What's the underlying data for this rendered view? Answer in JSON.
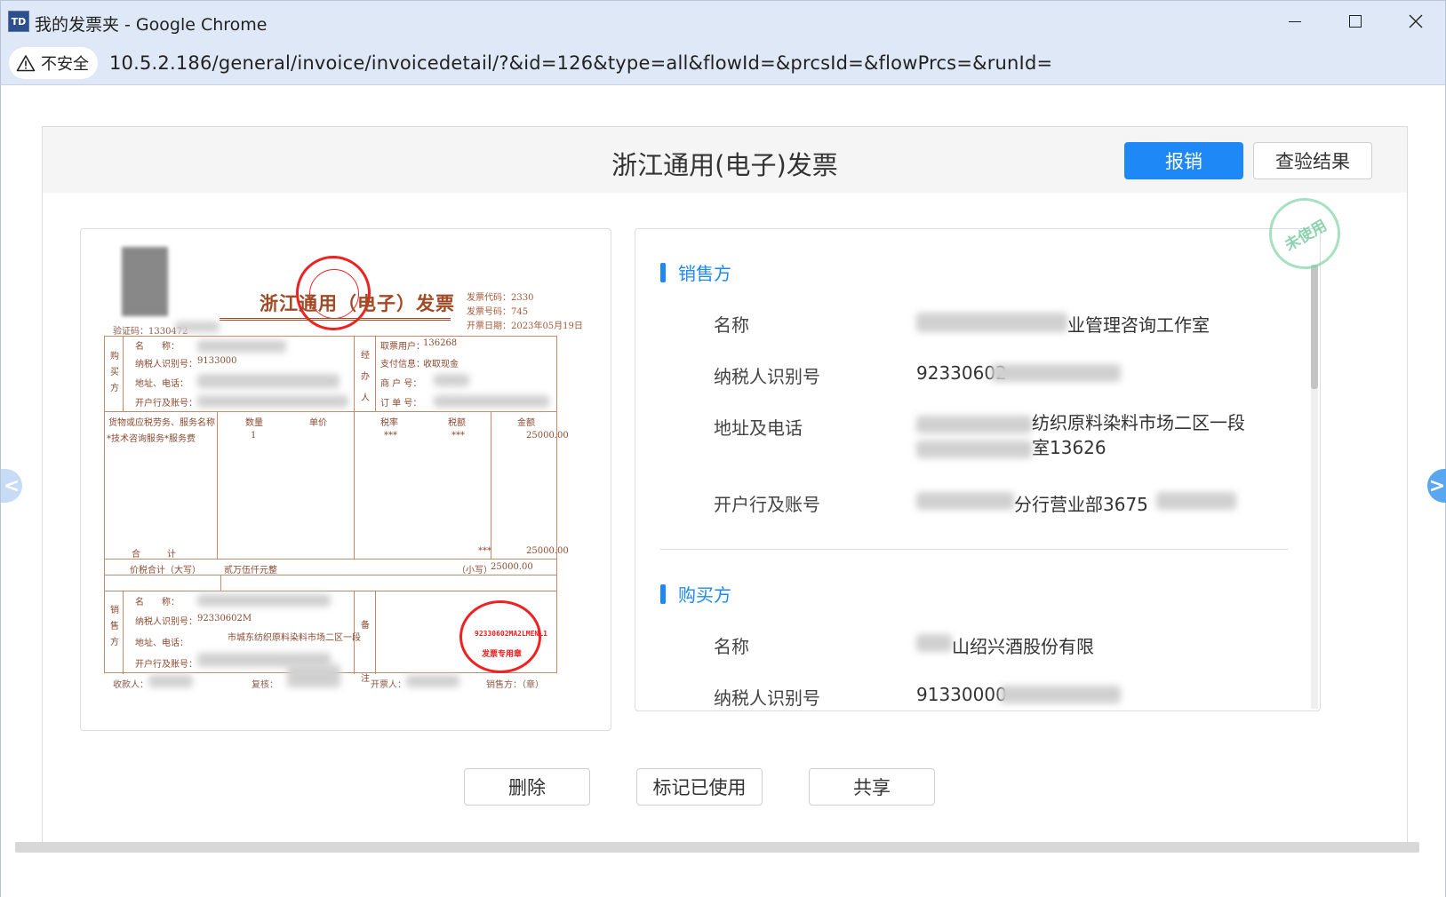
{
  "window": {
    "title": "我的发票夹 - Google Chrome",
    "app_icon": "TD"
  },
  "addressbar": {
    "security_label": "不安全",
    "url": "10.5.2.186/general/invoice/invoicedetail/?&id=126&type=all&flowId=&prcsId=&flowPrcs=&runId="
  },
  "dialog": {
    "title": "浙江通用(电子)发票",
    "reimburse_label": "报销",
    "verify_label": "查验结果",
    "unused_stamp": "未使用"
  },
  "invoice_image": {
    "title": "浙江通用（电子）发票",
    "meta": [
      "发票代码：2330",
      "发票号码：745",
      "开票日期：2023年05月19日"
    ],
    "check_code": "验证码：1330472",
    "buyer_side": "购买方",
    "buyer_rows": [
      "名　　称：",
      "纳税人识别号：",
      "地址、电话：",
      "开户行及账号："
    ],
    "buyer_taxid": "9133000",
    "agent_side": "经办人",
    "agent_rows": [
      "取票用户：",
      "支付信息：",
      "商 户 号：",
      "订 单 号："
    ],
    "agent_user": "136268",
    "agent_pay": "收取现金",
    "item_headers": [
      "货物或应税劳务、服务名称",
      "数量",
      "单价",
      "税率",
      "税额",
      "金额"
    ],
    "item_name": "*技术咨询服务*服务费",
    "item_qty": "1",
    "item_rate": "***",
    "item_tax": "***",
    "item_amount": "25000.00",
    "total_label": "合　　　计",
    "total_amount": "25000.00",
    "total_tax": "***",
    "sum_label": "价税合计（大写）",
    "sum_text": "贰万伍仟元整",
    "sum_small_label": "（小写）",
    "sum_small": "25000.00",
    "seller_side": "销售方",
    "seller_rows": [
      "名　　称：",
      "纳税人识别号：",
      "地址、电话：",
      "开户行及账号："
    ],
    "seller_taxid": "92330602M",
    "seller_addr": "市城东纺织原料染料市场二区一段",
    "remark_side": "备注",
    "footer": [
      "收款人：",
      "复核：",
      "开票人：",
      "销售方：（章）"
    ],
    "stamp_code": "92330602MA2LMENL1",
    "stamp_text": "发票专用章"
  },
  "seller": {
    "heading": "销售方",
    "fields": [
      {
        "label": "名称",
        "value": "业管理咨询工作室"
      },
      {
        "label": "纳税人识别号",
        "value": "92330602"
      },
      {
        "label": "地址及电话",
        "value": "纺织原料染料市场二区一段 室13626"
      },
      {
        "label": "开户行及账号",
        "value": "分行营业部3675"
      }
    ]
  },
  "buyer": {
    "heading": "购买方",
    "fields": [
      {
        "label": "名称",
        "value": "山绍兴酒股份有限"
      },
      {
        "label": "纳税人识别号",
        "value": "91330000"
      }
    ]
  },
  "actions": {
    "delete_label": "删除",
    "mark_used_label": "标记已使用",
    "share_label": "共享"
  },
  "nav": {
    "prev": "<",
    "next": ">"
  }
}
